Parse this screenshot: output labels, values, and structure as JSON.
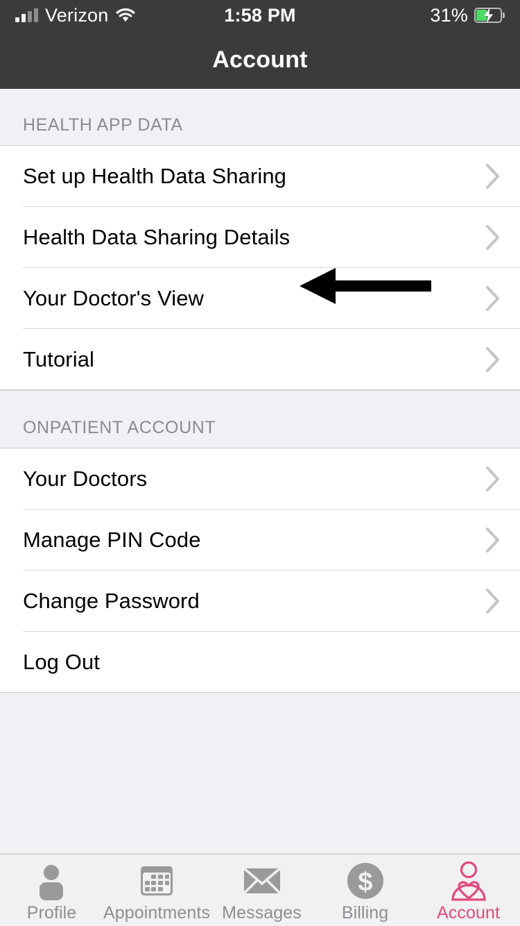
{
  "status_bar": {
    "carrier": "Verizon",
    "signal_bars_filled": 2,
    "signal_bars_total": 4,
    "wifi_icon": "wifi-icon",
    "time": "1:58 PM",
    "battery_percent": "31%",
    "battery_level": 31,
    "battery_charging": true,
    "battery_fill_color": "#4cd964"
  },
  "nav": {
    "title": "Account",
    "background_color": "#3b3b3b",
    "title_color": "#ffffff"
  },
  "annotation": {
    "type": "arrow",
    "direction": "left",
    "color": "#000000",
    "points_at": "Set up Health Data Sharing"
  },
  "sections": [
    {
      "header": "HEALTH APP DATA",
      "rows": [
        {
          "label": "Set up Health Data Sharing",
          "chevron": true
        },
        {
          "label": "Health Data Sharing Details",
          "chevron": true
        },
        {
          "label": "Your Doctor's View",
          "chevron": true
        },
        {
          "label": "Tutorial",
          "chevron": true
        }
      ]
    },
    {
      "header": "ONPATIENT ACCOUNT",
      "rows": [
        {
          "label": "Your Doctors",
          "chevron": true
        },
        {
          "label": "Manage PIN Code",
          "chevron": true
        },
        {
          "label": "Change Password",
          "chevron": true
        },
        {
          "label": "Log Out",
          "chevron": false
        }
      ]
    }
  ],
  "tab_bar": {
    "active_index": 4,
    "active_color": "#e2497f",
    "inactive_color": "#9a9a9a",
    "label_color": "#8e8e93",
    "tabs": [
      {
        "label": "Profile",
        "icon": "person-icon"
      },
      {
        "label": "Appointments",
        "icon": "calendar-icon"
      },
      {
        "label": "Messages",
        "icon": "envelope-icon"
      },
      {
        "label": "Billing",
        "icon": "dollar-circle-icon"
      },
      {
        "label": "Account",
        "icon": "person-heart-icon"
      }
    ]
  },
  "colors": {
    "header_background": "#3b3b3b",
    "page_background": "#f1f1f5",
    "row_background": "#ffffff",
    "separator": "#d8d8dc",
    "section_header_text": "#8a8a8f",
    "row_text": "#000000",
    "chevron": "#c4c4c9",
    "accent_pink": "#e2497f"
  }
}
